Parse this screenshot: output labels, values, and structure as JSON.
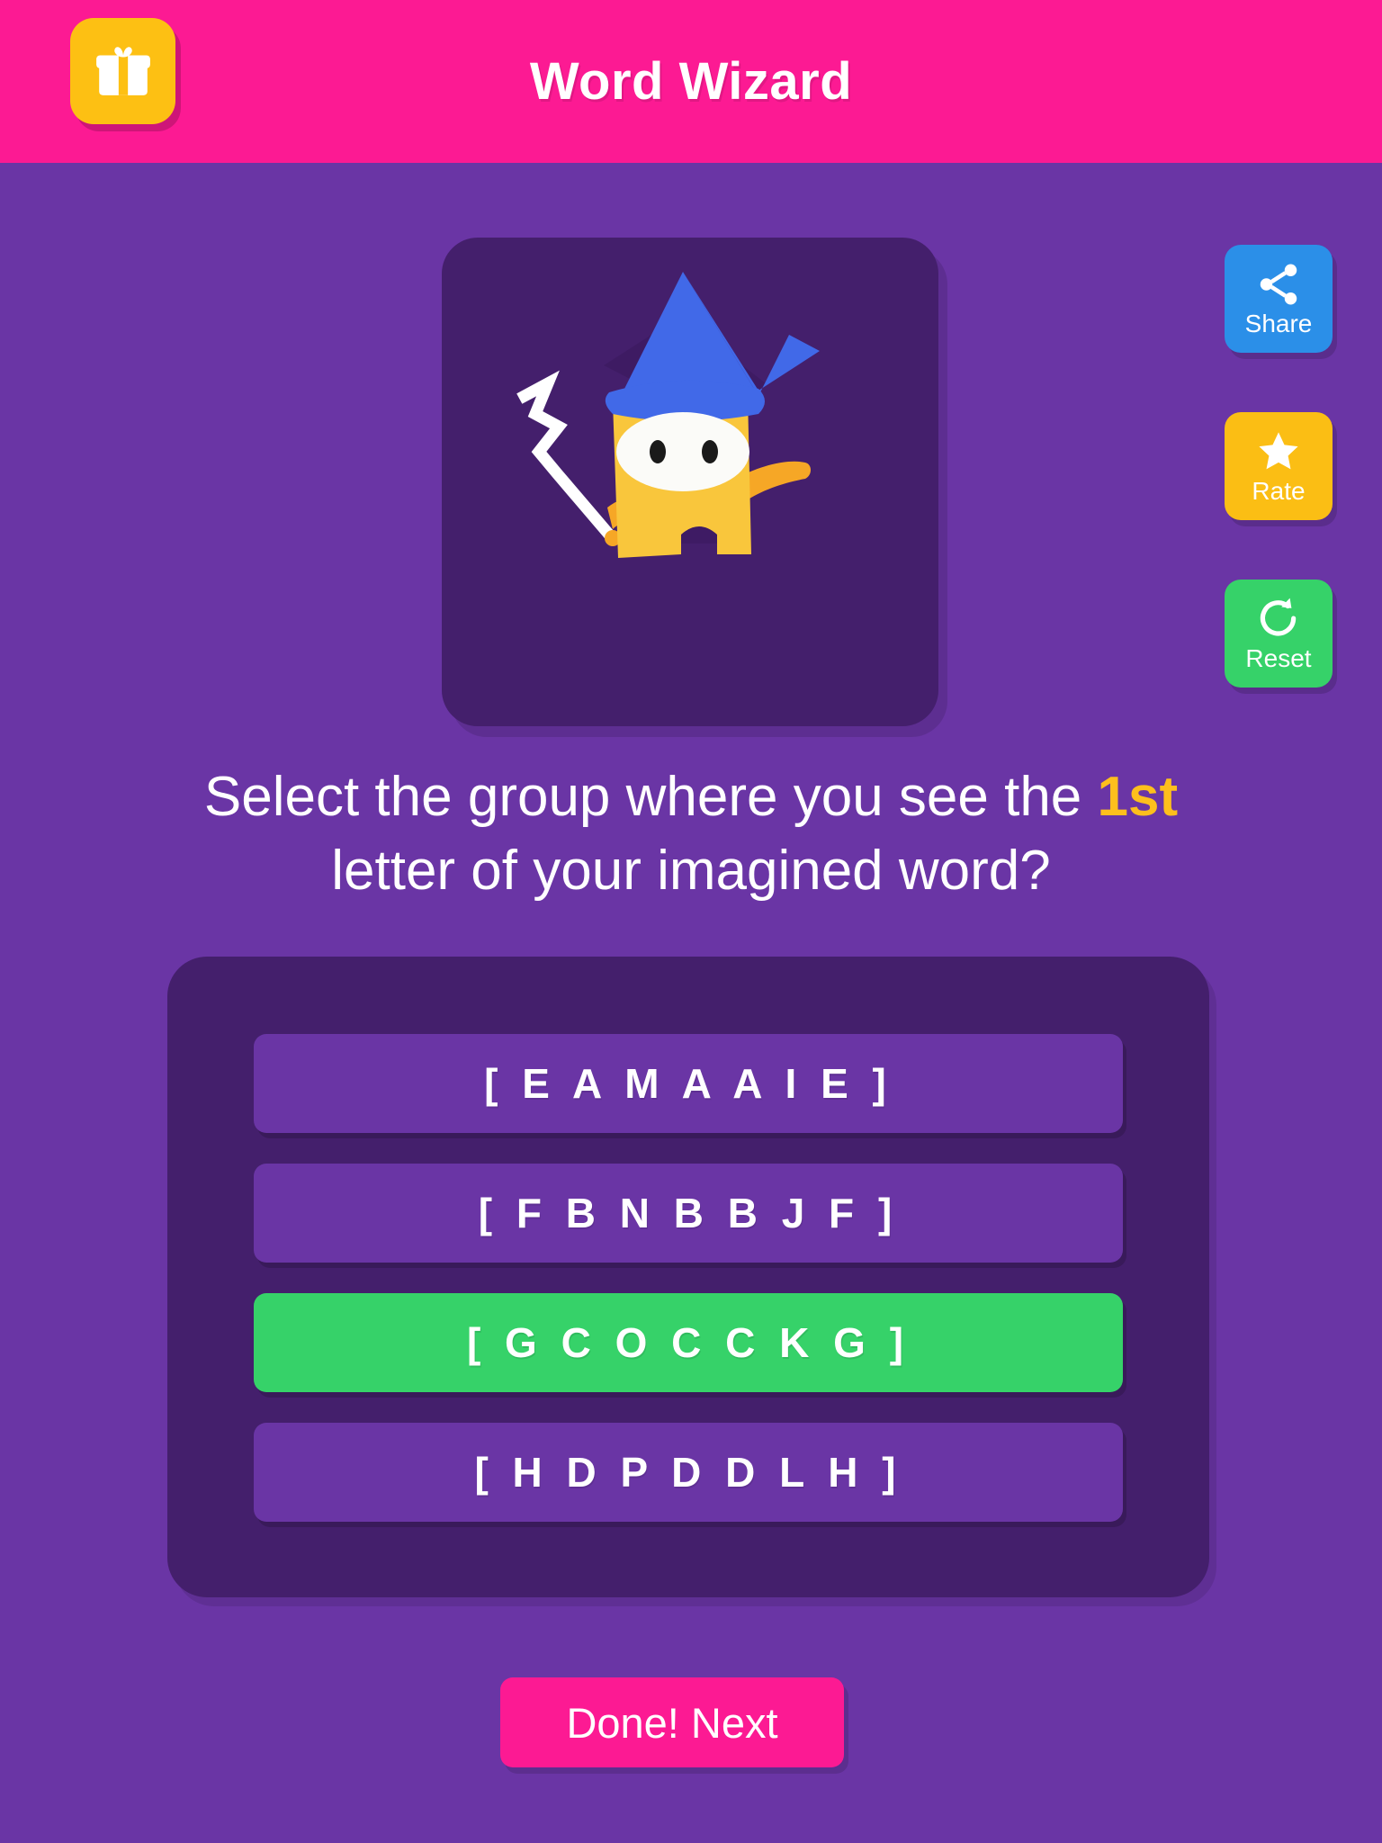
{
  "header": {
    "title": "Word Wizard",
    "gift_icon": "gift-icon",
    "background_color": "#FC1A93"
  },
  "hero": {
    "illustration": "wizard-character-illustration",
    "card_color": "#441F6C",
    "hat_color": "#4169E8",
    "body_color": "#F9C63C",
    "wand_color": "#FFFFFF"
  },
  "side_actions": [
    {
      "label": "Share",
      "icon": "share-icon",
      "color": "#2B8FE8"
    },
    {
      "label": "Rate",
      "icon": "star-icon",
      "color": "#FBBE14"
    },
    {
      "label": "Reset",
      "icon": "refresh-icon",
      "color": "#36D269"
    }
  ],
  "question": {
    "part1": "Select the group where you see the ",
    "highlight": "1st",
    "part2": "letter of your imagined word?",
    "highlight_color": "#FDBF1D"
  },
  "options": [
    {
      "label": "[ E A M A A I E ]",
      "selected": false
    },
    {
      "label": "[ F B N B B J F ]",
      "selected": false
    },
    {
      "label": "[ G C O C C K G ]",
      "selected": true
    },
    {
      "label": "[ H D P D D L H ]",
      "selected": false
    }
  ],
  "selected_color": "#36D269",
  "option_color": "#6A35A5",
  "footer": {
    "next_label": "Done! Next",
    "next_color": "#FC1A93"
  },
  "background_color": "#6A35A5"
}
